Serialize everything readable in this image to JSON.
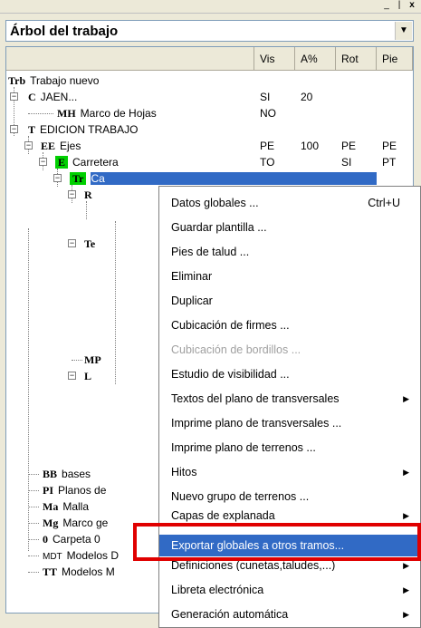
{
  "window": {
    "minimize": "_",
    "maximize": "|",
    "close": "x"
  },
  "combo": {
    "selected": "Árbol del trabajo"
  },
  "columns": [
    "Vis",
    "A%",
    "Rot",
    "Pie"
  ],
  "tree": [
    {
      "code": "Trb",
      "label": "Trabajo nuevo",
      "vis": "",
      "a": "",
      "rot": "",
      "pie": ""
    },
    {
      "code": "C",
      "label": "JAEN...",
      "vis": "SI",
      "a": "20",
      "rot": "",
      "pie": ""
    },
    {
      "code": "MH",
      "label": "Marco de Hojas",
      "vis": "NO",
      "a": "",
      "rot": "",
      "pie": ""
    },
    {
      "code": "T",
      "label": "EDICION TRABAJO",
      "vis": "",
      "a": "",
      "rot": "",
      "pie": ""
    },
    {
      "code": "EE",
      "label": "Ejes",
      "vis": "PE",
      "a": "100",
      "rot": "PE",
      "pie": "PE"
    },
    {
      "code": "E",
      "label": "Carretera",
      "vis": "TO",
      "a": "",
      "rot": "SI",
      "pie": "PT"
    },
    {
      "code": "Tr",
      "label": "Ca",
      "vis": "",
      "a": "",
      "rot": "",
      "pie": ""
    },
    {
      "code": "R",
      "label": "",
      "vis": "",
      "a": "",
      "rot": "",
      "pie": ""
    },
    {
      "code": "Te",
      "label": "",
      "vis": "",
      "a": "",
      "rot": "",
      "pie": ""
    },
    {
      "code": "MP",
      "label": "",
      "vis": "",
      "a": "",
      "rot": "",
      "pie": ""
    },
    {
      "code": "L",
      "label": "",
      "vis": "",
      "a": "",
      "rot": "",
      "pie": ""
    },
    {
      "code": "BB",
      "label": "bases",
      "vis": "",
      "a": "",
      "rot": "",
      "pie": ""
    },
    {
      "code": "PI",
      "label": "Planos de",
      "vis": "",
      "a": "",
      "rot": "",
      "pie": ""
    },
    {
      "code": "Ma",
      "label": "Malla",
      "vis": "",
      "a": "",
      "rot": "",
      "pie": ""
    },
    {
      "code": "Mg",
      "label": "Marco ge",
      "vis": "",
      "a": "",
      "rot": "",
      "pie": ""
    },
    {
      "code": "0",
      "label": "Carpeta 0",
      "vis": "",
      "a": "",
      "rot": "",
      "pie": ""
    },
    {
      "code": "MDT",
      "label": "Modelos D",
      "vis": "",
      "a": "",
      "rot": "",
      "pie": ""
    },
    {
      "code": "TT",
      "label": "Modelos M",
      "vis": "",
      "a": "",
      "rot": "",
      "pie": ""
    }
  ],
  "menu": [
    {
      "label": "Datos globales ...",
      "shortcut": "Ctrl+U"
    },
    {
      "label": "Guardar plantilla ..."
    },
    {
      "label": "Pies de talud ..."
    },
    {
      "label": "Eliminar"
    },
    {
      "label": "Duplicar"
    },
    {
      "label": "Cubicación de firmes ..."
    },
    {
      "label": "Cubicación de bordillos ...",
      "disabled": true
    },
    {
      "label": "Estudio de visibilidad ..."
    },
    {
      "label": "Textos del plano de transversales",
      "submenu": true
    },
    {
      "label": "Imprime plano de transversales ..."
    },
    {
      "label": "Imprime plano de terrenos ..."
    },
    {
      "label": "Hitos",
      "submenu": true
    },
    {
      "label": "Nuevo grupo de terrenos ..."
    },
    {
      "label": "Capas de explanada",
      "submenu": true
    },
    {
      "label": "Exportar globales a otros tramos...",
      "highlighted": true
    },
    {
      "label": "Definiciones (cunetas,taludes,...)",
      "submenu": true
    },
    {
      "label": "Libreta electrónica",
      "submenu": true
    },
    {
      "label": "Generación automática",
      "submenu": true
    }
  ]
}
